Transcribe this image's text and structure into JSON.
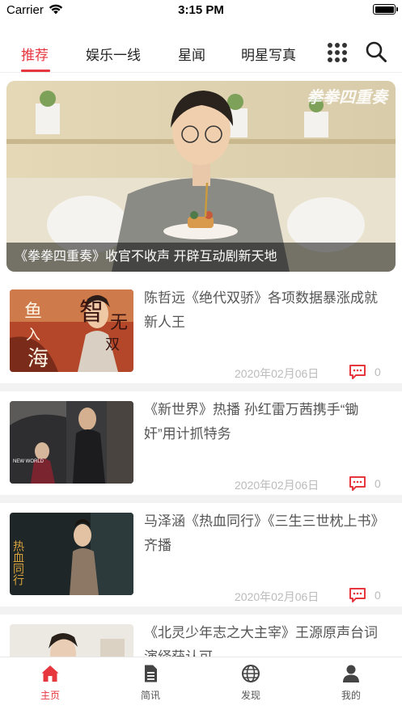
{
  "status": {
    "carrier": "Carrier",
    "time": "3:15 PM"
  },
  "tabs": [
    {
      "label": "推荐",
      "active": true
    },
    {
      "label": "娱乐一线"
    },
    {
      "label": "星闻"
    },
    {
      "label": "明星写真"
    }
  ],
  "banner": {
    "caption": "《拳拳四重奏》收官不收声 开辟互动剧新天地",
    "watermark": "拳拳四重奏"
  },
  "news": [
    {
      "title": "陈哲远《绝代双骄》各项数据暴涨成就新人王",
      "date": "2020年02月06日",
      "comments": "0"
    },
    {
      "title": "《新世界》热播 孙红雷万茜携手“锄奸”用计抓特务",
      "date": "2020年02月06日",
      "comments": "0"
    },
    {
      "title": "马泽涵《热血同行》《三生三世枕上书》齐播",
      "date": "2020年02月06日",
      "comments": "0"
    },
    {
      "title": "《北灵少年志之大主宰》王源原声台词演绎获认可",
      "date": "",
      "comments": ""
    }
  ],
  "thumb_text": {
    "item1": [
      "鱼",
      "入",
      "海",
      "智",
      "无",
      "双"
    ],
    "item2": "NEW WORLD",
    "item3": "热血同行"
  },
  "tabbar": [
    {
      "label": "主页",
      "icon": "home-icon",
      "active": true
    },
    {
      "label": "简讯",
      "icon": "document-icon"
    },
    {
      "label": "发现",
      "icon": "globe-icon"
    },
    {
      "label": "我的",
      "icon": "person-icon"
    }
  ],
  "colors": {
    "accent": "#e6373f",
    "divider": "#f2f2f2",
    "muted": "#bbbbbb"
  }
}
